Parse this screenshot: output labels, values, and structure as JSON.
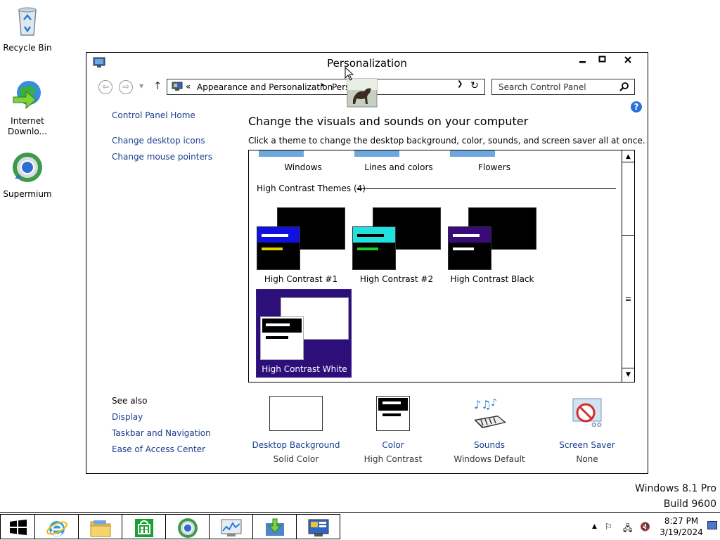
{
  "desktop": {
    "icons": [
      {
        "label": "Recycle Bin"
      },
      {
        "label": "Internet Downlo..."
      },
      {
        "label": "Supermium"
      }
    ]
  },
  "window": {
    "title": "Personalization",
    "address": {
      "chevron": "«",
      "crumb1": "Appearance and Personalization",
      "separator": "▸",
      "crumb2": "Pers"
    },
    "search": {
      "placeholder": "Search Control Panel"
    },
    "help": "?"
  },
  "left_pane": {
    "home": "Control Panel Home",
    "links": [
      "Change desktop icons",
      "Change mouse pointers"
    ],
    "see_also_label": "See also",
    "see_also": [
      "Display",
      "Taskbar and Navigation",
      "Ease of Access Center"
    ]
  },
  "main": {
    "heading": "Change the visuals and sounds on your computer",
    "description": "Click a theme to change the desktop background, color, sounds, and screen saver all at once.",
    "top_themes": [
      "Windows",
      "Lines and colors",
      "Flowers"
    ],
    "group_label": "High Contrast Themes (4)",
    "themes": [
      {
        "label": "High Contrast #1",
        "header_color": "#1010e0",
        "bar1": "#ffffff",
        "bar2": "#e0d000",
        "selected": false
      },
      {
        "label": "High Contrast #2",
        "header_color": "#20e0e0",
        "bar1": "#000000",
        "bar2": "#20d020",
        "selected": false
      },
      {
        "label": "High Contrast Black",
        "header_color": "#3a0a7a",
        "bar1": "#ffffff",
        "bar2": "#ffffff",
        "selected": false
      },
      {
        "label": "High Contrast White",
        "header_color": "#000000",
        "bar1": "#ffffff",
        "bar2": "#000000",
        "selected": true
      }
    ],
    "scroll_grip": "≡"
  },
  "options": {
    "background": {
      "title": "Desktop Background",
      "value": "Solid Color"
    },
    "color": {
      "title": "Color",
      "value": "High Contrast"
    },
    "sounds": {
      "title": "Sounds",
      "value": "Windows Default"
    },
    "saver": {
      "title": "Screen Saver",
      "value": "None"
    }
  },
  "watermark": {
    "line1": "Windows 8.1 Pro",
    "line2": "Build 9600"
  },
  "taskbar": {
    "clock_time": "8:27 PM",
    "clock_date": "3/19/2024"
  },
  "colors": {
    "link": "#1a3c8f",
    "selected_tile": "#2c0f78"
  }
}
